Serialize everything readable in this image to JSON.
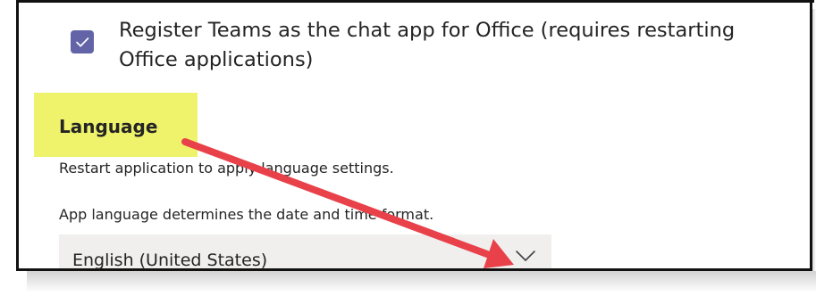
{
  "settings": {
    "chat_app_checkbox": {
      "label": "Register Teams as the chat app for Office (requires restarting Office applications)",
      "checked": true
    },
    "language": {
      "title": "Language",
      "restart_note": "Restart application to apply language settings.",
      "date_format_note": "App language determines the date and time format.",
      "selected_language": "English (United States)"
    }
  },
  "colors": {
    "checkbox_accent": "#6264a7",
    "highlight": "#eef36b",
    "annotation_arrow": "#e8414a",
    "dropdown_background": "#f0efee"
  },
  "icons": {
    "checkbox": "checkmark-icon",
    "dropdown": "chevron-down-icon",
    "annotation": "annotation-arrow"
  }
}
